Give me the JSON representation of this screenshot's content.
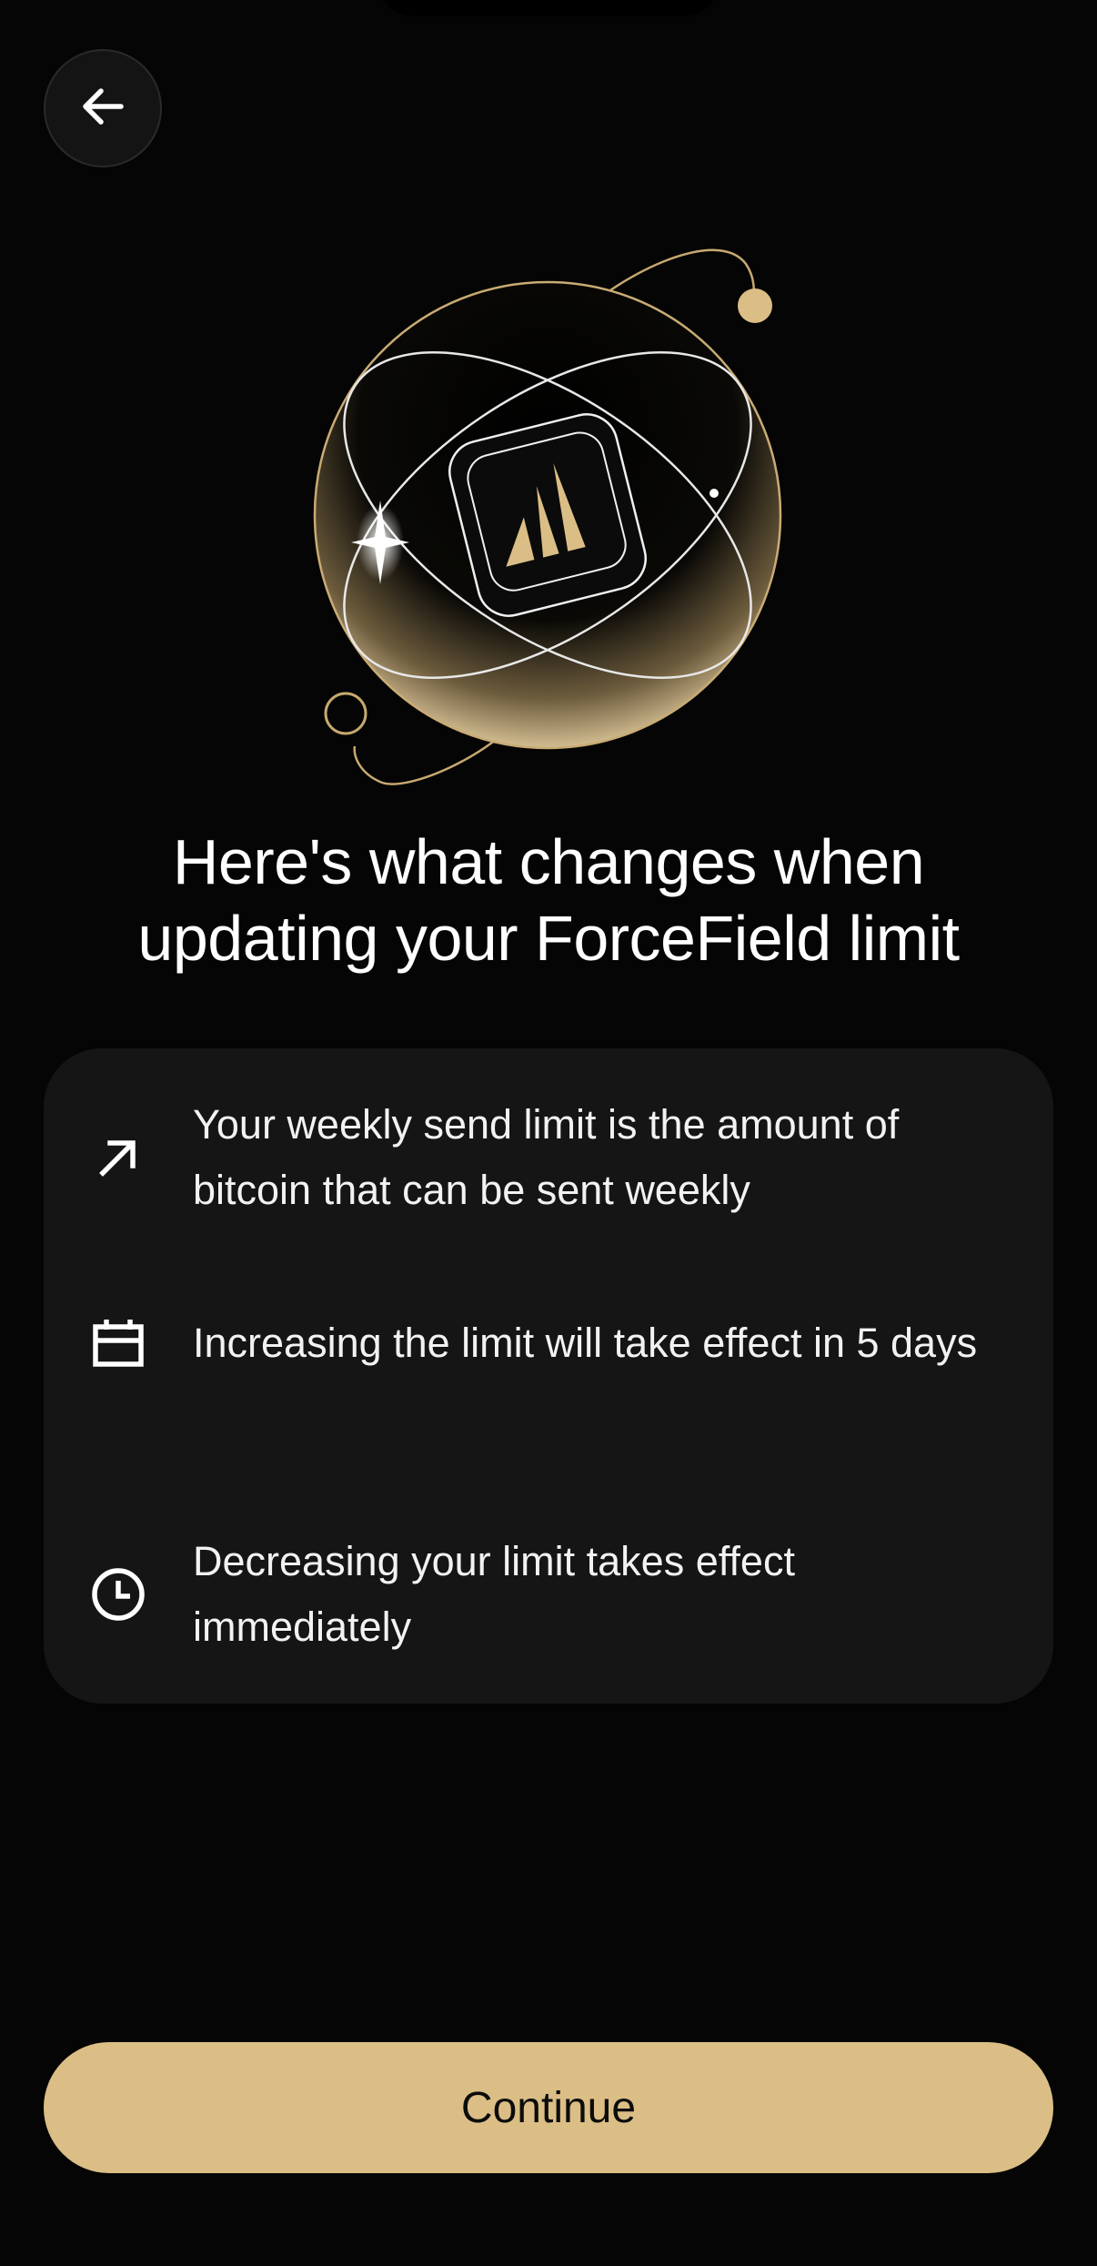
{
  "header": {
    "back_icon": "arrow-left-icon"
  },
  "hero": {
    "illustration": "forcefield-globe-illustration",
    "accent_color": "#dbbe85"
  },
  "title": "Here's what changes when updating your ForceField limit",
  "info_items": [
    {
      "icon": "arrow-up-right-icon",
      "text": "Your weekly send limit is the amount of bitcoin that can be sent weekly"
    },
    {
      "icon": "calendar-icon",
      "text": "Increasing the limit will take effect in 5 days"
    },
    {
      "icon": "clock-icon",
      "text": "Decreasing your limit takes effect immediately"
    }
  ],
  "footer": {
    "continue_label": "Continue",
    "button_color": "#dbbe85"
  }
}
